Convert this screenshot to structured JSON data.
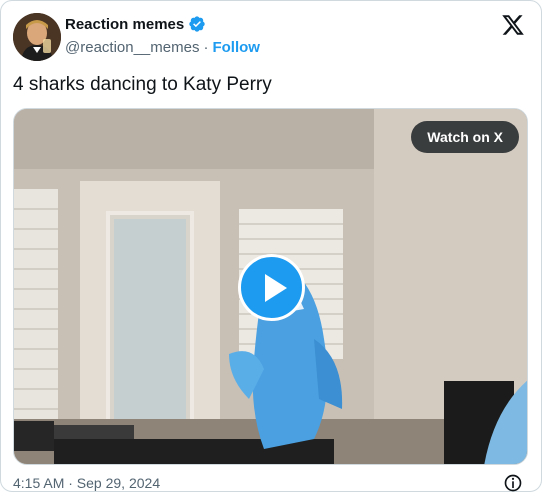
{
  "author": {
    "name": "Reaction memes",
    "handle": "@reaction__memes",
    "separator": "·",
    "follow_label": "Follow"
  },
  "tweet": {
    "text": "4 sharks dancing to Katy Perry"
  },
  "media": {
    "watch_label": "Watch on X"
  },
  "meta": {
    "timestamp": "4:15 AM · Sep 29, 2024"
  },
  "icons": {
    "verified": "verified-badge-icon",
    "logo": "x-logo-icon",
    "play": "play-icon",
    "info": "info-icon"
  },
  "colors": {
    "accent": "#1d9bf0",
    "text": "#0f1419",
    "muted": "#536471"
  }
}
